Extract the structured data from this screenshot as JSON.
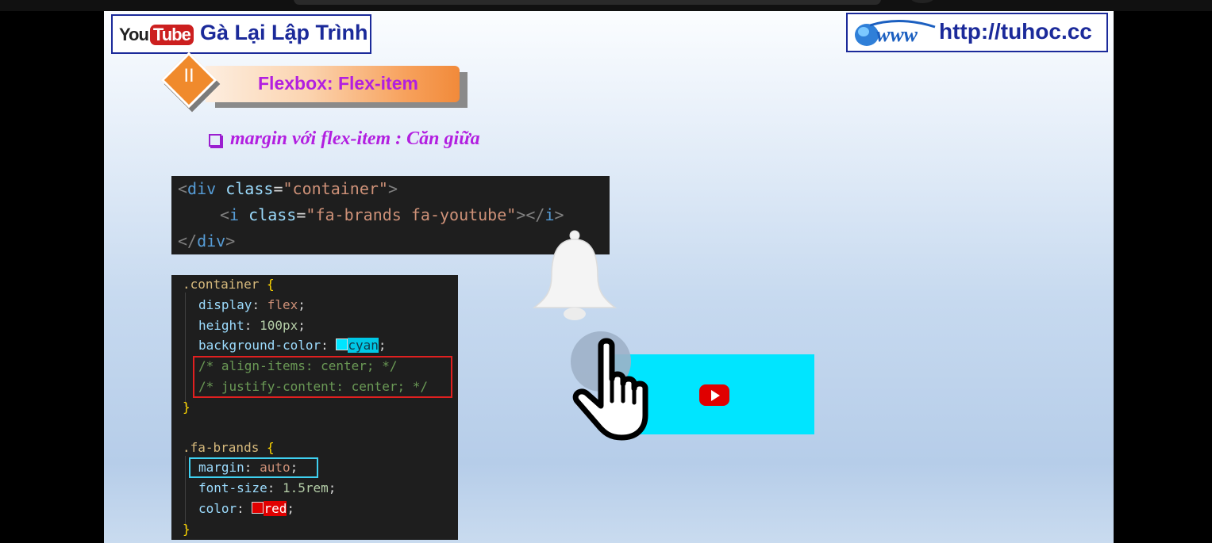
{
  "header": {
    "youtube_you": "You",
    "youtube_tube": "Tube",
    "channel_name": "Gà Lại Lập Trình",
    "site_url": "http://tuhoc.cc"
  },
  "section": {
    "number": "II",
    "title": "Flexbox: Flex-item"
  },
  "subtitle": "margin với flex-item  : Căn giữa",
  "html_code": [
    "<div class=\"container\">",
    "<i class=\"fa-brands fa-youtube\"></i>",
    "</div>"
  ],
  "css_code": {
    "container_selector": ".container",
    "display_prop": "display",
    "display_val": "flex",
    "height_prop": "height",
    "height_val": "100px",
    "bg_prop": "background-color",
    "bg_val": "cyan",
    "comment1": "/* align-items: center; */",
    "comment2": "/* justify-content: center; */",
    "brands_selector": ".fa-brands",
    "margin_prop": "margin",
    "margin_val": "auto",
    "font_prop": "font-size",
    "font_val": "1.5rem",
    "color_prop": "color",
    "color_val": "red"
  },
  "colors": {
    "cyan": "#00e5ff",
    "red": "#e00000",
    "accent_purple": "#b21fe0",
    "accent_orange": "#f08a2c",
    "brand_blue": "#1b2a9a"
  },
  "icons": [
    "youtube-logo",
    "globe-www-icon",
    "bell-icon",
    "hand-pointer-icon",
    "youtube-play-icon"
  ]
}
